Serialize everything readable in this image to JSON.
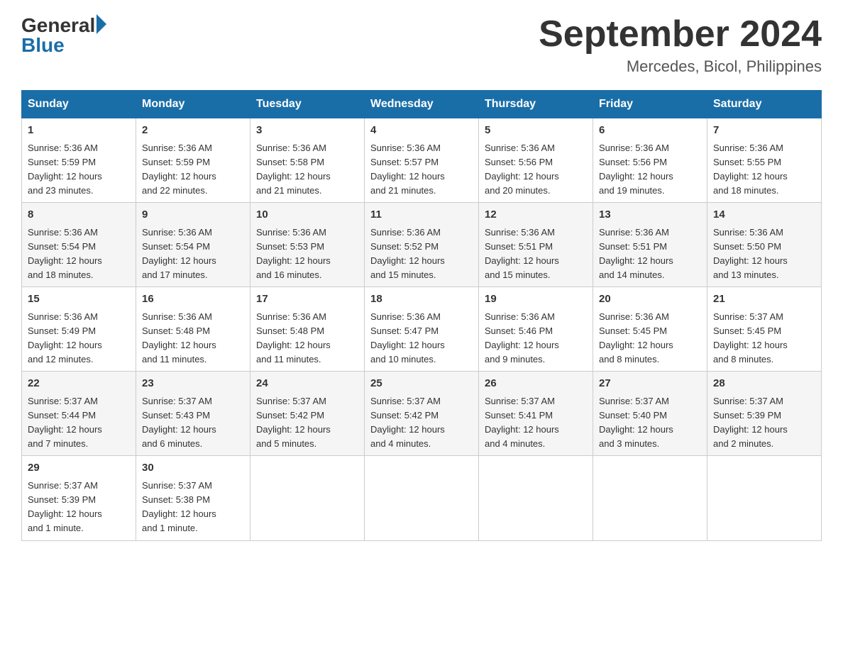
{
  "header": {
    "logo": {
      "general": "General",
      "blue": "Blue"
    },
    "title": "September 2024",
    "location": "Mercedes, Bicol, Philippines"
  },
  "calendar": {
    "days_of_week": [
      "Sunday",
      "Monday",
      "Tuesday",
      "Wednesday",
      "Thursday",
      "Friday",
      "Saturday"
    ],
    "weeks": [
      [
        {
          "day": "1",
          "sunrise": "5:36 AM",
          "sunset": "5:59 PM",
          "daylight": "12 hours and 23 minutes."
        },
        {
          "day": "2",
          "sunrise": "5:36 AM",
          "sunset": "5:59 PM",
          "daylight": "12 hours and 22 minutes."
        },
        {
          "day": "3",
          "sunrise": "5:36 AM",
          "sunset": "5:58 PM",
          "daylight": "12 hours and 21 minutes."
        },
        {
          "day": "4",
          "sunrise": "5:36 AM",
          "sunset": "5:57 PM",
          "daylight": "12 hours and 21 minutes."
        },
        {
          "day": "5",
          "sunrise": "5:36 AM",
          "sunset": "5:56 PM",
          "daylight": "12 hours and 20 minutes."
        },
        {
          "day": "6",
          "sunrise": "5:36 AM",
          "sunset": "5:56 PM",
          "daylight": "12 hours and 19 minutes."
        },
        {
          "day": "7",
          "sunrise": "5:36 AM",
          "sunset": "5:55 PM",
          "daylight": "12 hours and 18 minutes."
        }
      ],
      [
        {
          "day": "8",
          "sunrise": "5:36 AM",
          "sunset": "5:54 PM",
          "daylight": "12 hours and 18 minutes."
        },
        {
          "day": "9",
          "sunrise": "5:36 AM",
          "sunset": "5:54 PM",
          "daylight": "12 hours and 17 minutes."
        },
        {
          "day": "10",
          "sunrise": "5:36 AM",
          "sunset": "5:53 PM",
          "daylight": "12 hours and 16 minutes."
        },
        {
          "day": "11",
          "sunrise": "5:36 AM",
          "sunset": "5:52 PM",
          "daylight": "12 hours and 15 minutes."
        },
        {
          "day": "12",
          "sunrise": "5:36 AM",
          "sunset": "5:51 PM",
          "daylight": "12 hours and 15 minutes."
        },
        {
          "day": "13",
          "sunrise": "5:36 AM",
          "sunset": "5:51 PM",
          "daylight": "12 hours and 14 minutes."
        },
        {
          "day": "14",
          "sunrise": "5:36 AM",
          "sunset": "5:50 PM",
          "daylight": "12 hours and 13 minutes."
        }
      ],
      [
        {
          "day": "15",
          "sunrise": "5:36 AM",
          "sunset": "5:49 PM",
          "daylight": "12 hours and 12 minutes."
        },
        {
          "day": "16",
          "sunrise": "5:36 AM",
          "sunset": "5:48 PM",
          "daylight": "12 hours and 11 minutes."
        },
        {
          "day": "17",
          "sunrise": "5:36 AM",
          "sunset": "5:48 PM",
          "daylight": "12 hours and 11 minutes."
        },
        {
          "day": "18",
          "sunrise": "5:36 AM",
          "sunset": "5:47 PM",
          "daylight": "12 hours and 10 minutes."
        },
        {
          "day": "19",
          "sunrise": "5:36 AM",
          "sunset": "5:46 PM",
          "daylight": "12 hours and 9 minutes."
        },
        {
          "day": "20",
          "sunrise": "5:36 AM",
          "sunset": "5:45 PM",
          "daylight": "12 hours and 8 minutes."
        },
        {
          "day": "21",
          "sunrise": "5:37 AM",
          "sunset": "5:45 PM",
          "daylight": "12 hours and 8 minutes."
        }
      ],
      [
        {
          "day": "22",
          "sunrise": "5:37 AM",
          "sunset": "5:44 PM",
          "daylight": "12 hours and 7 minutes."
        },
        {
          "day": "23",
          "sunrise": "5:37 AM",
          "sunset": "5:43 PM",
          "daylight": "12 hours and 6 minutes."
        },
        {
          "day": "24",
          "sunrise": "5:37 AM",
          "sunset": "5:42 PM",
          "daylight": "12 hours and 5 minutes."
        },
        {
          "day": "25",
          "sunrise": "5:37 AM",
          "sunset": "5:42 PM",
          "daylight": "12 hours and 4 minutes."
        },
        {
          "day": "26",
          "sunrise": "5:37 AM",
          "sunset": "5:41 PM",
          "daylight": "12 hours and 4 minutes."
        },
        {
          "day": "27",
          "sunrise": "5:37 AM",
          "sunset": "5:40 PM",
          "daylight": "12 hours and 3 minutes."
        },
        {
          "day": "28",
          "sunrise": "5:37 AM",
          "sunset": "5:39 PM",
          "daylight": "12 hours and 2 minutes."
        }
      ],
      [
        {
          "day": "29",
          "sunrise": "5:37 AM",
          "sunset": "5:39 PM",
          "daylight": "12 hours and 1 minute."
        },
        {
          "day": "30",
          "sunrise": "5:37 AM",
          "sunset": "5:38 PM",
          "daylight": "12 hours and 1 minute."
        },
        null,
        null,
        null,
        null,
        null
      ]
    ],
    "labels": {
      "sunrise": "Sunrise:",
      "sunset": "Sunset:",
      "daylight": "Daylight:"
    }
  }
}
